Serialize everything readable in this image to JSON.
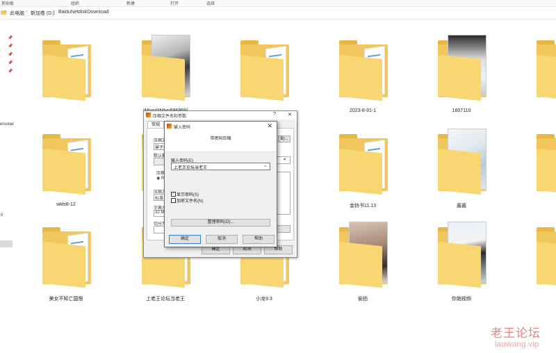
{
  "ribbon": {
    "items": [
      "剪贴板",
      "组织",
      "新建",
      "打开",
      "选择"
    ]
  },
  "breadcrumb": [
    "此电脑",
    "新加卷 (D:)",
    "BaiduNetdiskDownload"
  ],
  "nav": {
    "fragment": "ersonal",
    "drive_fragment": "0"
  },
  "items": [
    {
      "label": "",
      "kind": "folder"
    },
    {
      "label": "[Miyo@Miyo696969]",
      "kind": "photo"
    },
    {
      "label": "",
      "kind": "folder"
    },
    {
      "label": "2023-8-31-1",
      "kind": "folder"
    },
    {
      "label": "1607110",
      "kind": "photo"
    },
    {
      "label": "",
      "kind": "folder"
    },
    {
      "label": "wkls8-12",
      "kind": "folder"
    },
    {
      "label": "",
      "kind": "folder"
    },
    {
      "label": "",
      "kind": "folder"
    },
    {
      "label": "金铃书11.13",
      "kind": "folder"
    },
    {
      "label": "酱酱",
      "kind": "photo"
    },
    {
      "label": "",
      "kind": "folder"
    },
    {
      "label": "美女不知亡国恨",
      "kind": "folder"
    },
    {
      "label": "上老王论坛当老王",
      "kind": "folder"
    },
    {
      "label": "小龙9.3",
      "kind": "folder"
    },
    {
      "label": "偷拍",
      "kind": "photo"
    },
    {
      "label": "你她视频",
      "kind": "photo"
    },
    {
      "label": "",
      "kind": "folder"
    }
  ],
  "archive_dialog": {
    "title": "压缩文件名和参数",
    "help": "?",
    "close": "✕",
    "tab_general": "常规",
    "frag_name_label": "压缩文",
    "frag_name_value": "幂子相",
    "frag_browse": "B)...",
    "frag_default": "默认配",
    "frag_format": "压缩",
    "frag_format_opt": "RA",
    "frag_method": "压缩方",
    "frag_method_value": "标准",
    "frag_dict": "字典大",
    "frag_dict_value": "32 MB",
    "frag_split": "切分为",
    "ok": "确定",
    "cancel": "取消",
    "help_btn": "帮助"
  },
  "password_dialog": {
    "title": "输入密码",
    "close": "✕",
    "heading": "带密码压缩",
    "field_label": "输入密码(E)",
    "password_value": "上老王论坛当老王",
    "show_password": "显示密码(S)",
    "show_password_checked": true,
    "encrypt_names": "加密文件名(N)",
    "encrypt_names_checked": false,
    "manage_button": "整理密码(O)...",
    "ok": "确定",
    "cancel": "取消",
    "help": "帮助"
  },
  "watermark": {
    "line1": "老王论坛",
    "line2": "laowang.vip"
  }
}
